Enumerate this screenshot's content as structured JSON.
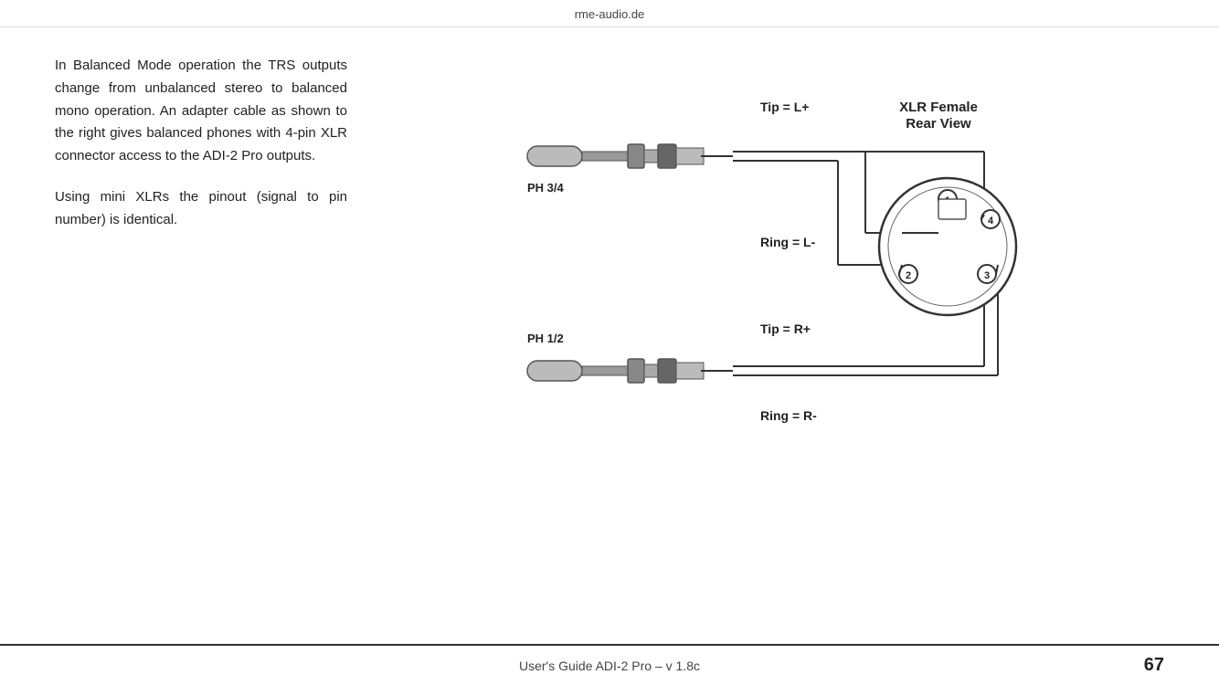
{
  "header": {
    "url": "rme-audio.de"
  },
  "text": {
    "paragraph1": "In Balanced Mode operation the TRS outputs change from unbalanced stereo to balanced mono operation. An adapter cable as shown to the right gives balanced phones with 4-pin XLR connector access to the ADI-2 Pro outputs.",
    "paragraph2": "Using mini XLRs the pinout (signal to pin number) is identical."
  },
  "diagram": {
    "tip_l_label": "Tip = L+",
    "ring_l_label": "Ring = L-",
    "tip_r_label": "Tip = R+",
    "ring_r_label": "Ring = R-",
    "xlr_label1": "XLR Female",
    "xlr_label2": "Rear View",
    "ph34_label": "PH 3/4",
    "ph12_label": "PH 1/2",
    "pin1": "1",
    "pin2": "2",
    "pin3": "3",
    "pin4": "4"
  },
  "footer": {
    "guide_text": "User's Guide ADI-2 Pro – v 1.8c",
    "page_number": "67"
  }
}
